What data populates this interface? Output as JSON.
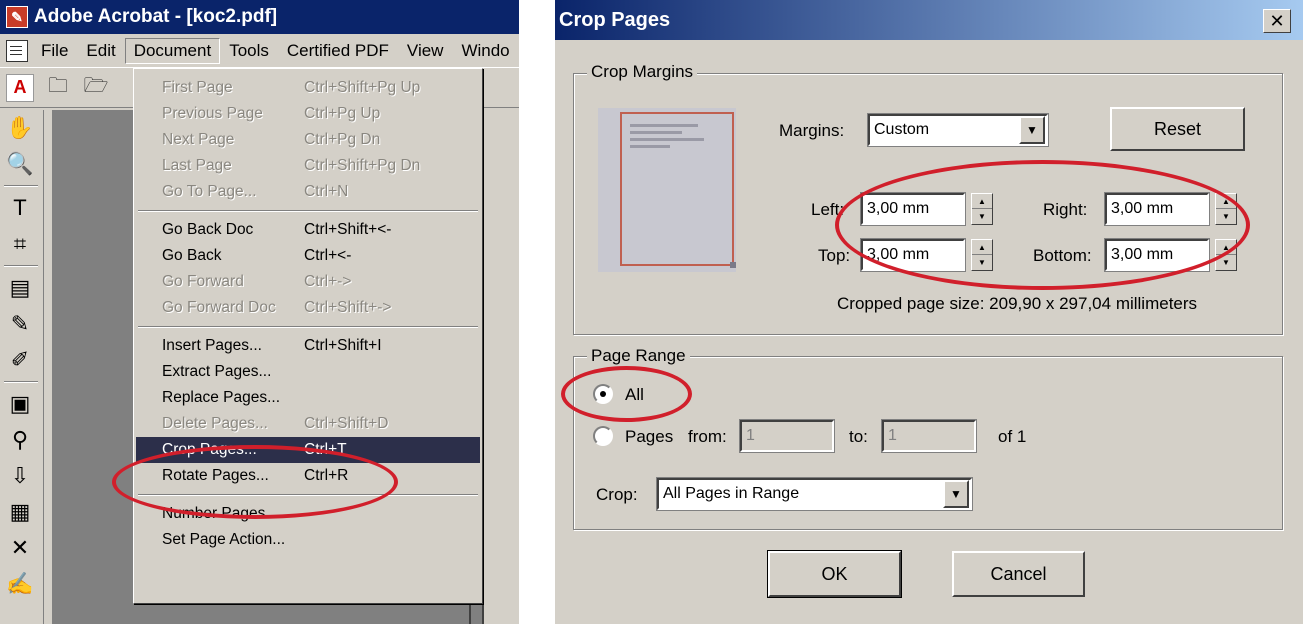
{
  "acrobat": {
    "title": "Adobe Acrobat - [koc2.pdf]",
    "menubar": [
      "File",
      "Edit",
      "Document",
      "Tools",
      "Certified PDF",
      "View",
      "Windo"
    ]
  },
  "document_menu": {
    "items": [
      {
        "label": "First Page",
        "shortcut": "Ctrl+Shift+Pg Up",
        "disabled": true
      },
      {
        "label": "Previous Page",
        "shortcut": "Ctrl+Pg Up",
        "disabled": true
      },
      {
        "label": "Next Page",
        "shortcut": "Ctrl+Pg Dn",
        "disabled": true
      },
      {
        "label": "Last Page",
        "shortcut": "Ctrl+Shift+Pg Dn",
        "disabled": true
      },
      {
        "label": "Go To Page...",
        "shortcut": "Ctrl+N",
        "disabled": true
      },
      {
        "label": "Go Back Doc",
        "shortcut": "Ctrl+Shift+<-",
        "disabled": false
      },
      {
        "label": "Go Back",
        "shortcut": "Ctrl+<-",
        "disabled": false
      },
      {
        "label": "Go Forward",
        "shortcut": "Ctrl+->",
        "disabled": true
      },
      {
        "label": "Go Forward Doc",
        "shortcut": "Ctrl+Shift+->",
        "disabled": true
      },
      {
        "label": "Insert Pages...",
        "shortcut": "Ctrl+Shift+I",
        "disabled": false
      },
      {
        "label": "Extract Pages...",
        "shortcut": "",
        "disabled": false
      },
      {
        "label": "Replace Pages...",
        "shortcut": "",
        "disabled": false
      },
      {
        "label": "Delete Pages...",
        "shortcut": "Ctrl+Shift+D",
        "disabled": true
      },
      {
        "label": "Crop Pages...",
        "shortcut": "Ctrl+T",
        "disabled": false,
        "selected": true
      },
      {
        "label": "Rotate Pages...",
        "shortcut": "Ctrl+R",
        "disabled": false
      },
      {
        "label": "Number Pages...",
        "shortcut": "",
        "disabled": false
      },
      {
        "label": "Set Page Action...",
        "shortcut": "",
        "disabled": false
      }
    ]
  },
  "crop_dialog": {
    "title": "Crop Pages",
    "close_label": "✕",
    "margins_group": "Crop Margins",
    "margins_label": "Margins:",
    "margins_value": "Custom",
    "reset_label": "Reset",
    "left_label": "Left:",
    "left_value": "3,00 mm",
    "right_label": "Right:",
    "right_value": "3,00 mm",
    "top_label": "Top:",
    "top_value": "3,00 mm",
    "bottom_label": "Bottom:",
    "bottom_value": "3,00 mm",
    "cropped_size": "Cropped page size: 209,90 x 297,04 millimeters",
    "range_group": "Page Range",
    "all_label": "All",
    "pages_label": "Pages",
    "from_label": "from:",
    "from_value": "1",
    "to_label": "to:",
    "to_value": "1",
    "of_label": "of 1",
    "crop_label": "Crop:",
    "crop_value": "All Pages in Range",
    "ok_label": "OK",
    "cancel_label": "Cancel"
  },
  "colors": {
    "annotation": "#d11f2b",
    "window_bg": "#d4d0c8",
    "titlebar": "#0a246a",
    "menu_highlight": "#2c2f4a"
  }
}
